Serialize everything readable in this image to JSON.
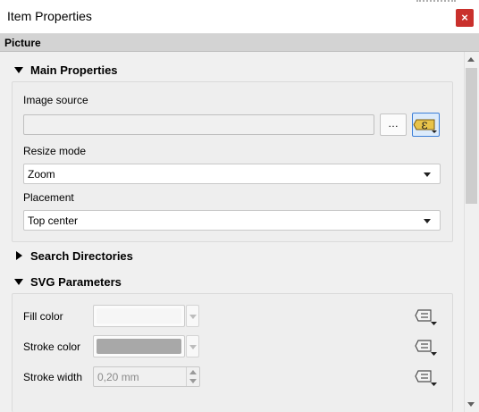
{
  "window": {
    "title": "Item Properties",
    "close_glyph": "×"
  },
  "panel": {
    "section_title": "Picture"
  },
  "main_properties": {
    "title": "Main Properties",
    "expanded": true,
    "image_source_label": "Image source",
    "image_source_value": "",
    "browse_button_label": "…",
    "resize_mode_label": "Resize mode",
    "resize_mode_value": "Zoom",
    "placement_label": "Placement",
    "placement_value": "Top center"
  },
  "search_directories": {
    "title": "Search Directories",
    "expanded": false
  },
  "svg_parameters": {
    "title": "SVG Parameters",
    "expanded": true,
    "fill_color_label": "Fill color",
    "fill_color": "#f6f6f6",
    "stroke_color_label": "Stroke color",
    "stroke_color": "#a8a8a8",
    "stroke_width_label": "Stroke width",
    "stroke_width_value": "0,20 mm"
  },
  "icons": {
    "close": "close-icon",
    "expression": "expression-epsilon-icon",
    "data_defined": "data-defined-override-icon",
    "collapse": "triangle-down-icon",
    "expand": "triangle-right-icon"
  },
  "colors": {
    "accent": "#3c7fd8",
    "close_button": "#c9302c",
    "header_bg": "#d3d3d3"
  }
}
